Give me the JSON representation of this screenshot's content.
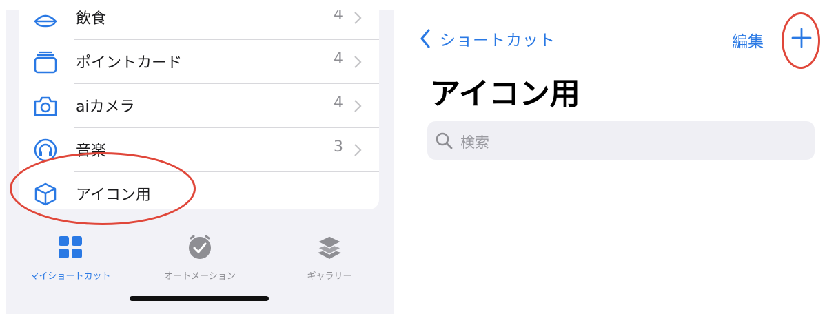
{
  "colors": {
    "accent": "#2a79e4",
    "annotation": "#e0473a",
    "secondary": "#8e8e93"
  },
  "list": {
    "items": [
      {
        "icon": "food-icon",
        "label": "飲食",
        "count": "4"
      },
      {
        "icon": "point-card-icon",
        "label": "ポイントカード",
        "count": "4"
      },
      {
        "icon": "camera-icon",
        "label": "aiカメラ",
        "count": "4"
      },
      {
        "icon": "headphones-icon",
        "label": "音楽",
        "count": "3"
      },
      {
        "icon": "cube-icon",
        "label": "アイコン用",
        "count": ""
      }
    ]
  },
  "tabbar": {
    "tabs": [
      {
        "icon": "grid-icon",
        "label": "マイショートカット",
        "active": true
      },
      {
        "icon": "clock-check-icon",
        "label": "オートメーション",
        "active": false
      },
      {
        "icon": "layers-icon",
        "label": "ギャラリー",
        "active": false
      }
    ]
  },
  "detail": {
    "back_label": "ショートカット",
    "edit_label": "編集",
    "add_icon": "plus-icon",
    "title": "アイコン用",
    "search_placeholder": "検索"
  }
}
